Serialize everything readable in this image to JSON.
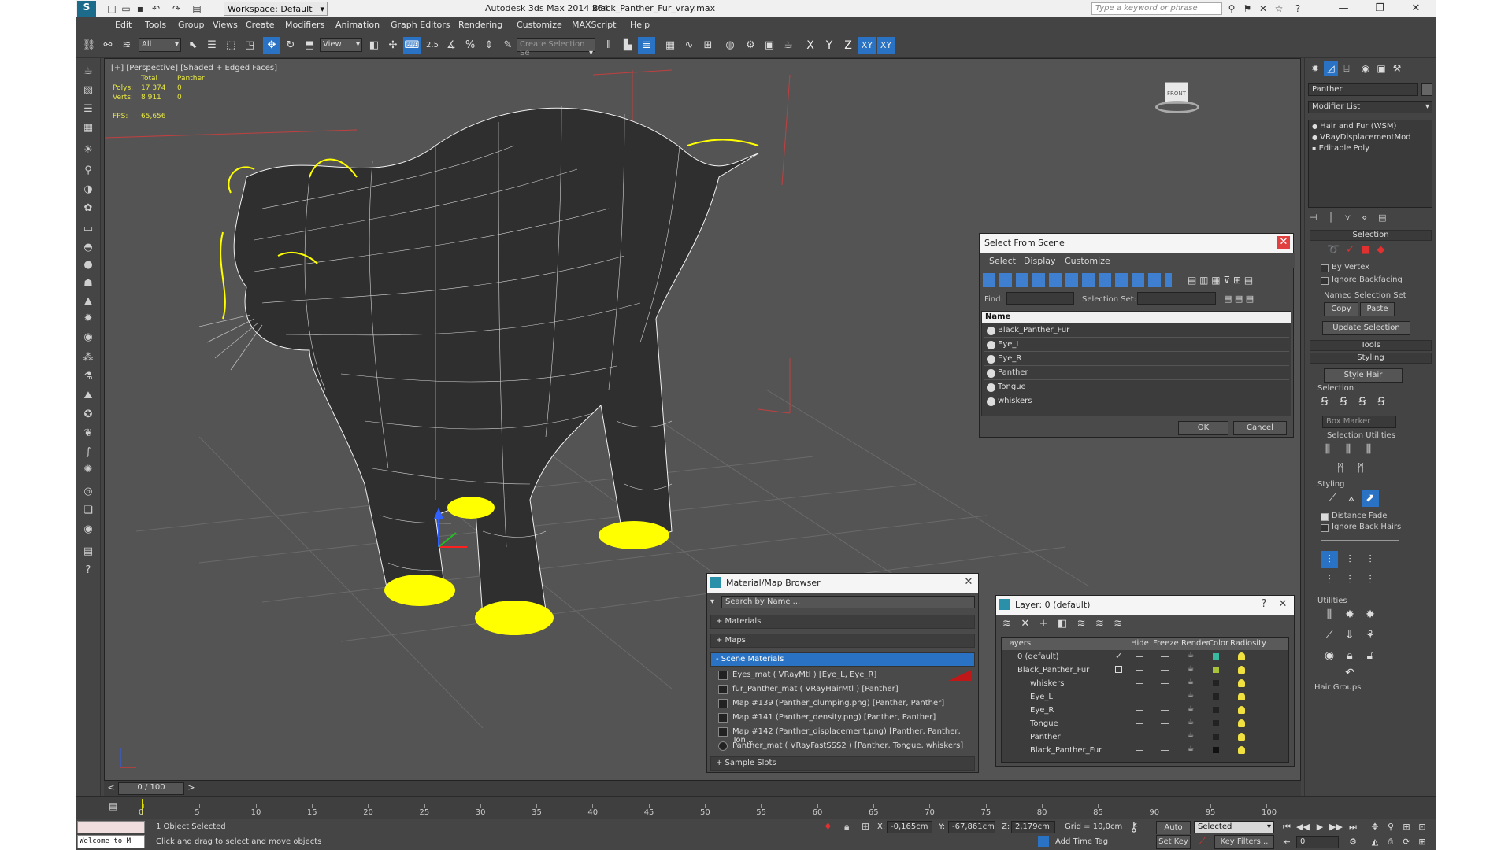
{
  "title": {
    "app": "Autodesk 3ds Max  2014 x64",
    "file": "Black_Panther_Fur_vray.max",
    "workspace": "Workspace: Default",
    "help_placeholder": "Type a keyword or phrase"
  },
  "menu": [
    "Edit",
    "Tools",
    "Group",
    "Views",
    "Create",
    "Modifiers",
    "Animation",
    "Graph Editors",
    "Rendering",
    "Customize",
    "MAXScript",
    "Help"
  ],
  "toolbar": {
    "filter": "All",
    "refcoord": "View",
    "snap_angle": "2.5",
    "selection_set_placeholder": "Create Selection Se",
    "axes": [
      "X",
      "Y",
      "Z",
      "XY",
      "XY"
    ]
  },
  "viewport": {
    "label": "[+] [Perspective] [Shaded + Edged Faces]",
    "stats": {
      "col_total": "Total",
      "col_obj": "Panther",
      "polys_label": "Polys:",
      "polys_total": "17 374",
      "polys_obj": "0",
      "verts_label": "Verts:",
      "verts_total": "8 911",
      "verts_obj": "0",
      "fps_label": "FPS:",
      "fps": "65,656"
    },
    "cube_label": "FRONT"
  },
  "select_from_scene": {
    "title": "Select From Scene",
    "menu": [
      "Select",
      "Display",
      "Customize"
    ],
    "find_label": "Find:",
    "selset_label": "Selection Set:",
    "col_name": "Name",
    "items": [
      "Black_Panther_Fur",
      "Eye_L",
      "Eye_R",
      "Panther",
      "Tongue",
      "whiskers"
    ],
    "ok": "OK",
    "cancel": "Cancel"
  },
  "material_browser": {
    "title": "Material/Map Browser",
    "search": "Search by Name ...",
    "sections": [
      "+ Materials",
      "+ Maps",
      "- Scene Materials",
      "+ Sample Slots"
    ],
    "items": [
      "Eyes_mat  ( VRayMtl )  [Eye_L, Eye_R]",
      "fur_Panther_mat  ( VRayHairMtl )  [Panther]",
      "Map #139 (Panther_clumping.png)  [Panther, Panther]",
      "Map #141 (Panther_density.png)  [Panther, Panther]",
      "Map #142 (Panther_displacement.png)  [Panther, Panther, Ton...",
      "Panther_mat  ( VRayFastSSS2 )  [Panther, Tongue, whiskers]"
    ]
  },
  "layer_dialog": {
    "title": "Layer: 0 (default)",
    "help": "?",
    "headers": [
      "Layers",
      "Hide",
      "Freeze",
      "Render",
      "Color",
      "Radiosity"
    ],
    "rows": [
      {
        "name": "0 (default)",
        "color": "#3bb8a0"
      },
      {
        "name": "Black_Panther_Fur",
        "color": "#a6c33a"
      },
      {
        "name": "whiskers",
        "color": "#222222"
      },
      {
        "name": "Eye_L",
        "color": "#222222"
      },
      {
        "name": "Eye_R",
        "color": "#222222"
      },
      {
        "name": "Tongue",
        "color": "#222222"
      },
      {
        "name": "Panther",
        "color": "#222222"
      },
      {
        "name": "Black_Panther_Fur",
        "color": "#111111"
      }
    ]
  },
  "command_panel": {
    "object_name": "Panther",
    "modifier_list": "Modifier List",
    "stack": [
      "Hair and Fur (WSM)",
      "VRayDisplacementMod",
      "Editable Poly"
    ],
    "selection_rollout": "Selection",
    "by_vertex": "By Vertex",
    "ignore_backfacing": "Ignore Backfacing",
    "named_sel": "Named Selection Set",
    "copy": "Copy",
    "paste": "Paste",
    "update_sel": "Update Selection",
    "tools": "Tools",
    "styling": "Styling",
    "style_hair": "Style Hair",
    "sel_label": "Selection",
    "box_marker": "Box Marker",
    "sel_utils": "Selection Utilities",
    "styling_label": "Styling",
    "distance_fade": "Distance Fade",
    "ignore_back_hairs": "Ignore Back Hairs",
    "utilities": "Utilities",
    "hair_groups": "Hair Groups"
  },
  "timeline": {
    "frame": "0 / 100",
    "ticks": [
      "0",
      "5",
      "10",
      "15",
      "20",
      "25",
      "30",
      "35",
      "40",
      "45",
      "50",
      "55",
      "60",
      "65",
      "70",
      "75",
      "80",
      "85",
      "90",
      "95",
      "100"
    ]
  },
  "status": {
    "listener": "Welcome to M",
    "selected": "1 Object Selected",
    "prompt": "Click and drag to select and move objects",
    "x_label": "X:",
    "x": "-0,165cm",
    "y_label": "Y:",
    "y": "-67,861cm",
    "z_label": "Z:",
    "z": "2,179cm",
    "grid": "Grid = 10,0cm",
    "add_time_tag": "Add Time Tag",
    "auto_key": "Auto Key",
    "set_key": "Set Key",
    "key_mode": "Selected",
    "key_filters": "Key Filters...",
    "frame_field": "0"
  },
  "colors": {
    "accent": "#2a73c4",
    "wire": "#ffff00",
    "bg": "#444444"
  }
}
